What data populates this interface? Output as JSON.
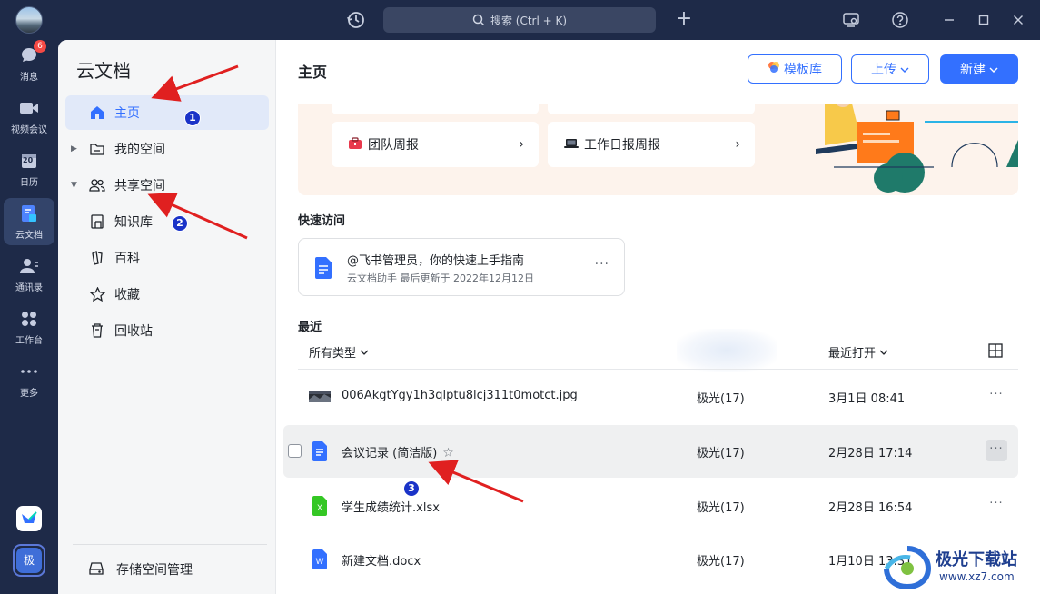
{
  "topbar": {
    "search_placeholder": "搜索 (Ctrl + K)"
  },
  "rail": {
    "items": [
      {
        "label": "消息",
        "badge": "6"
      },
      {
        "label": "视频会议"
      },
      {
        "label": "日历",
        "icon_text": "20"
      },
      {
        "label": "云文档"
      },
      {
        "label": "通讯录"
      },
      {
        "label": "工作台"
      },
      {
        "label": "更多"
      }
    ],
    "user_avatar_text": "极"
  },
  "sidebar": {
    "title": "云文档",
    "items": [
      {
        "label": "主页"
      },
      {
        "label": "我的空间"
      },
      {
        "label": "共享空间"
      },
      {
        "label": "知识库"
      },
      {
        "label": "百科"
      },
      {
        "label": "收藏"
      },
      {
        "label": "回收站"
      }
    ],
    "storage_label": "存储空间管理"
  },
  "header": {
    "title": "主页",
    "template_button": "模板库",
    "upload_button": "上传",
    "new_button": "新建"
  },
  "banner": {
    "cards": [
      {
        "label": "团队周报"
      },
      {
        "label": "工作日报周报"
      }
    ]
  },
  "quick_access": {
    "title": "快速访问",
    "card_title": "@飞书管理员，你的快速上手指南",
    "card_meta": "云文档助手  最后更新于 2022年12月12日",
    "more": "···"
  },
  "recent": {
    "title": "最近",
    "filter_type": "所有类型",
    "filter_time": "最近打开",
    "rows": [
      {
        "name": "006AkgtYgy1h3qlptu8lcj311t0motct.jpg",
        "owner": "极光(17)",
        "time": "3月1日 08:41",
        "more": "···"
      },
      {
        "name": "会议记录 (简洁版)",
        "owner": "极光(17)",
        "time": "2月28日 17:14",
        "more": "···"
      },
      {
        "name": "学生成绩统计.xlsx",
        "owner": "极光(17)",
        "time": "2月28日 16:54",
        "more": "···"
      },
      {
        "name": "新建文档.docx",
        "owner": "极光(17)",
        "time": "1月10日 13:31",
        "more": "···"
      }
    ]
  },
  "annotations": [
    "1",
    "2",
    "3"
  ],
  "watermark": {
    "line1": "极光下载站",
    "line2": "www.xz7.com"
  },
  "colors": {
    "accent": "#3370ff",
    "rail_bg": "#1e2a48",
    "arrow": "#e02020",
    "badge": "#1a33c8"
  }
}
